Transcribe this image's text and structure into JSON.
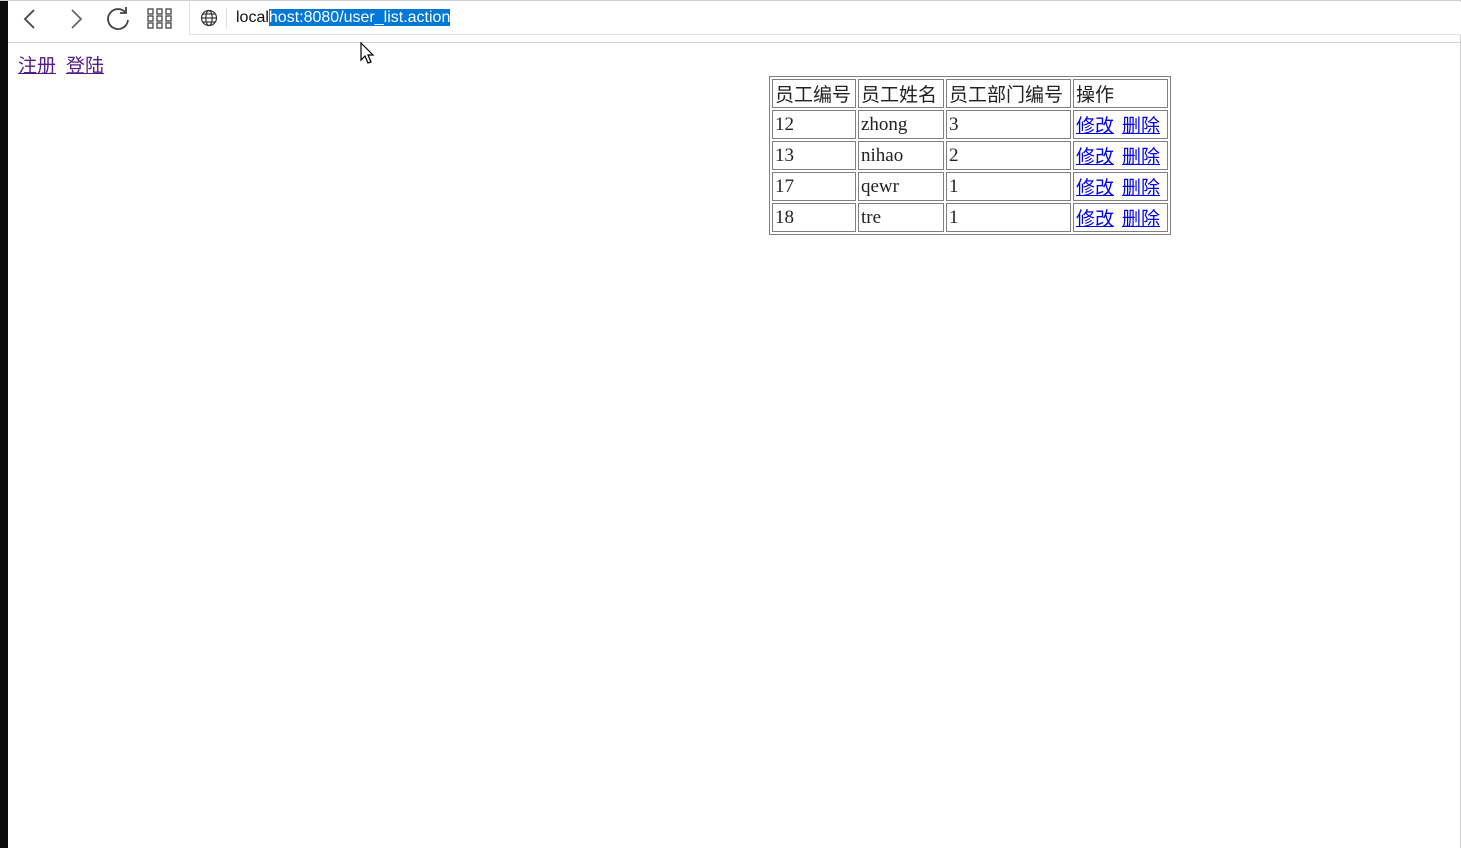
{
  "browser": {
    "url_unselected": "local",
    "url_selected": "host:8080/user_list.action"
  },
  "page": {
    "links": {
      "register": "注册",
      "login": "登陆"
    },
    "table": {
      "headers": [
        "员工编号",
        "员工姓名",
        "员工部门编号",
        "操作"
      ],
      "rows": [
        {
          "id": "12",
          "name": "zhong",
          "dept": "3"
        },
        {
          "id": "13",
          "name": "nihao",
          "dept": "2"
        },
        {
          "id": "17",
          "name": "qewr",
          "dept": "1"
        },
        {
          "id": "18",
          "name": "tre",
          "dept": "1"
        }
      ],
      "edit_label": "修改",
      "delete_label": "删除"
    }
  },
  "colors": {
    "visited_link": "#551a8b",
    "link": "#0000ee",
    "selection": "#0078d7"
  }
}
